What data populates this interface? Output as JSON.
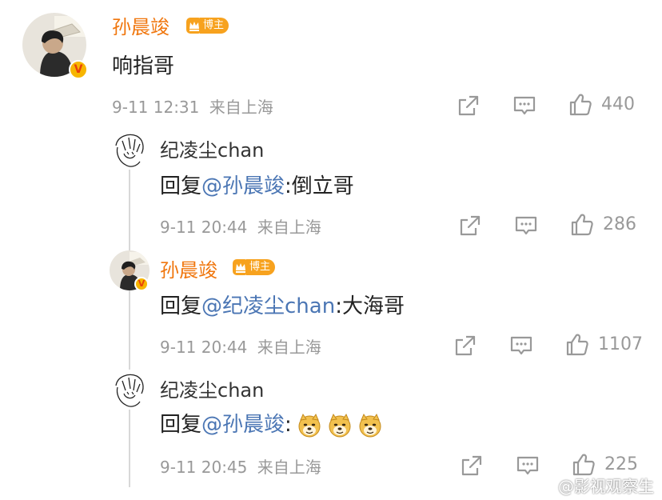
{
  "main_comment": {
    "user": "孙晨竣",
    "badge": "博主",
    "text": "响指哥",
    "time": "9-11 12:31",
    "location": "来自上海",
    "likes": "440"
  },
  "replies": [
    {
      "user": "纪凌尘chan",
      "reply_prefix": "回复",
      "mention": "@孙晨竣",
      "text": ":倒立哥",
      "time": "9-11 20:44",
      "location": "来自上海",
      "likes": "286"
    },
    {
      "user": "孙晨竣",
      "badge": "博主",
      "reply_prefix": "回复",
      "mention": "@纪凌尘chan",
      "text": ":大海哥",
      "time": "9-11 20:44",
      "location": "来自上海",
      "likes": "1107"
    },
    {
      "user": "纪凌尘chan",
      "reply_prefix": "回复",
      "mention": "@孙晨竣",
      "text": ":",
      "emojis": [
        "doge-emoji",
        "doge-emoji",
        "doge-emoji"
      ],
      "time": "9-11 20:45",
      "location": "来自上海",
      "likes": "225"
    }
  ],
  "watermark": "@影视观察生",
  "colors": {
    "orange_name": "#f0760d",
    "mention": "#4b76b4",
    "meta": "#999999",
    "badge": "#f7a21e"
  }
}
